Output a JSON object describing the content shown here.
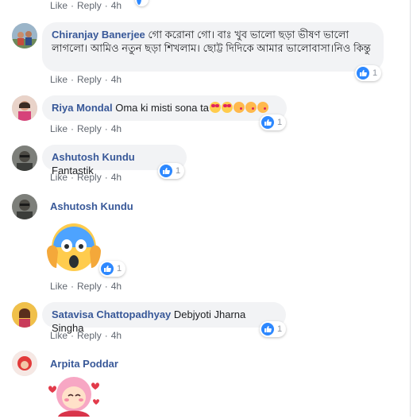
{
  "comments": [
    {
      "name": "",
      "text": "",
      "like_label": "Like",
      "reply_label": "Reply",
      "time": "4h"
    },
    {
      "name": "Chiranjay Banerjee",
      "text": "গো করোনা গো। বাঃ খুব ভালো ছড়া ভীষণ ভালো লাগলো। আমিও নতুন ছড়া শিখলাম। ছোট্ট দিদিকে আমার ভালোবাসা।নিও কিন্তু",
      "reactions": "1",
      "like_label": "Like",
      "reply_label": "Reply",
      "time": "4h"
    },
    {
      "name": "Riya Mondal",
      "text": "Oma ki misti sona ta",
      "emojis": [
        "heart-eyes-emoji",
        "heart-eyes-emoji",
        "kiss-emoji",
        "kiss-emoji",
        "kiss-emoji"
      ],
      "reactions": "1",
      "like_label": "Like",
      "reply_label": "Reply",
      "time": "4h"
    },
    {
      "name": "Ashutosh Kundu",
      "text": "Fantastik",
      "reactions": "1",
      "like_label": "Like",
      "reply_label": "Reply",
      "time": "4h"
    },
    {
      "name": "Ashutosh Kundu",
      "sticker": "screaming-face-sticker",
      "reactions": "1",
      "like_label": "Like",
      "reply_label": "Reply",
      "time": "4h"
    },
    {
      "name": "Satavisa Chattopadhyay",
      "text": "Debjyoti Jharna Singha",
      "reactions": "1",
      "like_label": "Like",
      "reply_label": "Reply",
      "time": "4h"
    },
    {
      "name": "Arpita Poddar",
      "sticker": "girl-with-hearts-sticker"
    }
  ],
  "colors": {
    "name": "#385898",
    "bubble": "#f2f3f5",
    "like_blue": "#2d88ff",
    "meta": "#616770"
  }
}
